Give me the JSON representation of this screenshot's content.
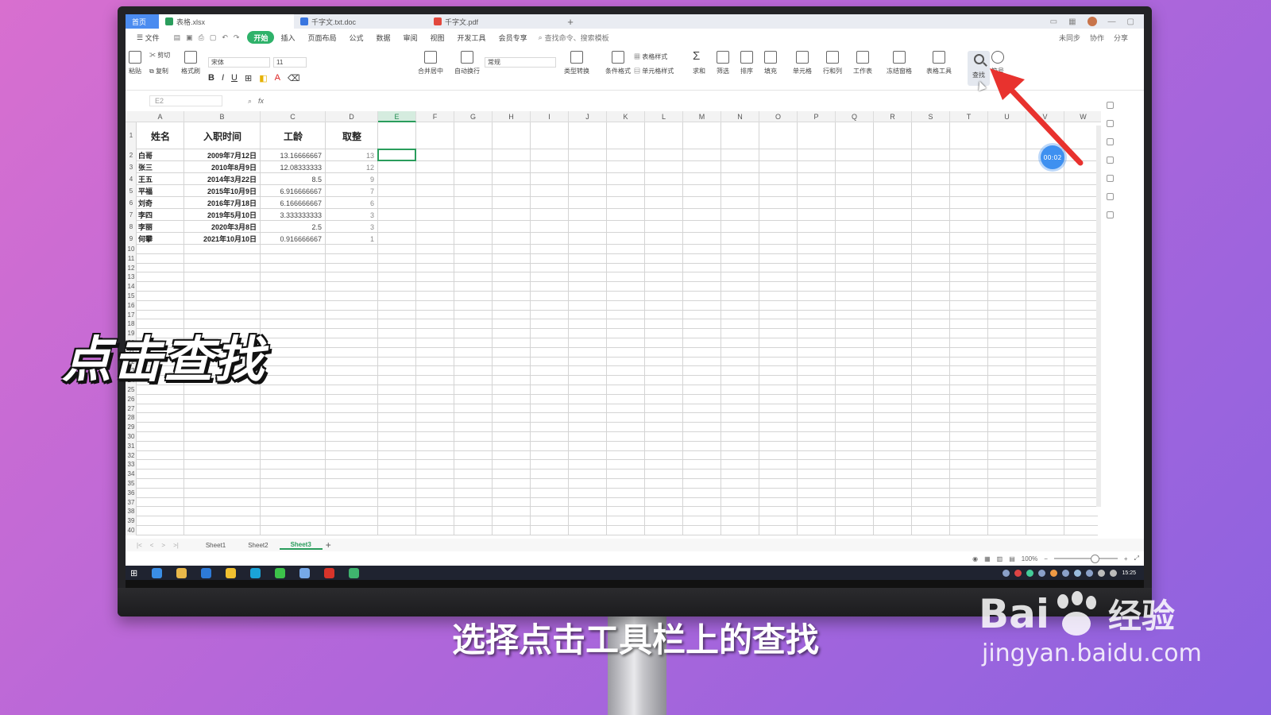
{
  "tabs": [
    {
      "label": "首页"
    },
    {
      "label": "表格.xlsx"
    },
    {
      "label": "千字文.txt.doc"
    },
    {
      "label": "千字文.pdf"
    }
  ],
  "menu": {
    "file": "文件",
    "items": [
      "开始",
      "插入",
      "页面布局",
      "公式",
      "数据",
      "审阅",
      "视图",
      "开发工具",
      "会员专享"
    ],
    "search_cmd": "查找命令、搜索模板",
    "right": [
      "未同步",
      "协作",
      "分享"
    ]
  },
  "ribbon": {
    "paste": "粘贴",
    "cut": "剪切",
    "copy": "复制",
    "format_painter": "格式刷",
    "font": "宋体",
    "size": "11",
    "merge": "合并居中",
    "wrap": "自动换行",
    "number_format": "常规",
    "type_convert": "类型转换",
    "cond_format": "条件格式",
    "table_style": "表格样式",
    "cell_style": "单元格样式",
    "sum": "求和",
    "filter": "筛选",
    "sort": "排序",
    "fill": "填充",
    "cell": "单元格",
    "rowcol": "行和列",
    "worksheet": "工作表",
    "freeze": "冻结窗格",
    "table_tools": "表格工具",
    "find": "查找",
    "symbol": "符号"
  },
  "formula_bar": {
    "cell_ref": "E2",
    "fx": "fx"
  },
  "columns": [
    "A",
    "B",
    "C",
    "D",
    "E",
    "F",
    "G",
    "H",
    "I",
    "J",
    "K",
    "L",
    "M",
    "N",
    "O",
    "P",
    "Q",
    "R",
    "S",
    "T",
    "U",
    "V",
    "W"
  ],
  "selected_column": "E",
  "table": {
    "headers": [
      "姓名",
      "入职时间",
      "工龄",
      "取整"
    ],
    "rows": [
      [
        "白哥",
        "2009年7月12日",
        "13.16666667",
        "13"
      ],
      [
        "张三",
        "2010年8月9日",
        "12.08333333",
        "12"
      ],
      [
        "王五",
        "2014年3月22日",
        "8.5",
        "9"
      ],
      [
        "平福",
        "2015年10月9日",
        "6.916666667",
        "7"
      ],
      [
        "刘奇",
        "2016年7月18日",
        "6.166666667",
        "6"
      ],
      [
        "李四",
        "2019年5月10日",
        "3.333333333",
        "3"
      ],
      [
        "李丽",
        "2020年3月8日",
        "2.5",
        "3"
      ],
      [
        "何攀",
        "2021年10月10日",
        "0.916666667",
        "1"
      ]
    ]
  },
  "sheets": [
    "Sheet1",
    "Sheet2",
    "Sheet3"
  ],
  "active_sheet": "Sheet3",
  "status": {
    "zoom": "100%"
  },
  "taskbar": {
    "time": "15:25"
  },
  "timer": "00:02",
  "overlay_title": "点击查找",
  "subtitle": "选择点击工具栏上的查找",
  "watermark": {
    "brand_a": "Bai",
    "brand_b": "经验",
    "url": "jingyan.baidu.com"
  },
  "colors": {
    "accent": "#2a9d5c",
    "arrow": "#e8322e",
    "tab_home": "#4b8cf0",
    "timer": "#3e90f0"
  }
}
